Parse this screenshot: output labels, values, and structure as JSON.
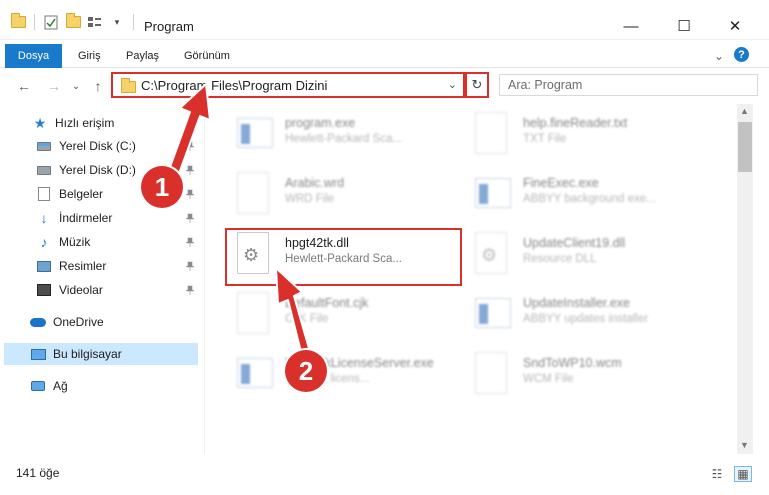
{
  "window": {
    "title": "Program",
    "minimize_glyph": "—",
    "maximize_glyph": "☐",
    "close_glyph": "✕"
  },
  "ribbon": {
    "tabs": [
      "Dosya",
      "Giriş",
      "Paylaş",
      "Görünüm"
    ],
    "chevron_glyph": "⌄",
    "help_glyph": "?"
  },
  "nav": {
    "back_glyph": "←",
    "forward_glyph": "→",
    "recent_glyph": "⌄",
    "up_glyph": "↑",
    "address_path": "C:\\Program Files\\Program Dizini",
    "address_dropdown_glyph": "⌄",
    "refresh_glyph": "↻",
    "search_placeholder": "Ara: Program"
  },
  "sidebar": {
    "items": [
      {
        "label": "Hızlı erişim",
        "icon": "star-icon"
      },
      {
        "label": "Yerel Disk (C:)",
        "icon": "drive-icon",
        "pinned": true
      },
      {
        "label": "Yerel Disk (D:)",
        "icon": "drive-icon",
        "pinned": true
      },
      {
        "label": "Belgeler",
        "icon": "document-icon",
        "pinned": true
      },
      {
        "label": "İndirmeler",
        "icon": "download-icon",
        "pinned": true
      },
      {
        "label": "Müzik",
        "icon": "music-icon",
        "pinned": true
      },
      {
        "label": "Resimler",
        "icon": "pictures-icon",
        "pinned": true
      },
      {
        "label": "Videolar",
        "icon": "videos-icon",
        "pinned": true
      },
      {
        "label": "OneDrive",
        "icon": "cloud-icon"
      },
      {
        "label": "Bu bilgisayar",
        "icon": "computer-icon",
        "selected": true
      },
      {
        "label": "Ağ",
        "icon": "network-icon"
      }
    ],
    "pin_glyph": "📌"
  },
  "files": [
    {
      "name": "program.exe",
      "type": "Hewlett-Packard Sca...",
      "icon": "application-icon"
    },
    {
      "name": "help.fineReader.txt",
      "type": "TXT File",
      "icon": "text-file-icon"
    },
    {
      "name": "Arabic.wrd",
      "type": "WRD File",
      "icon": "file-icon"
    },
    {
      "name": "FineExec.exe",
      "type": "ABBYY background exe...",
      "icon": "application-icon"
    },
    {
      "name": "hpgt42tk.dll",
      "type": "Hewlett-Packard Sca...",
      "icon": "dll-gear-icon",
      "highlighted": true
    },
    {
      "name": "UpdateClient19.dll",
      "type": "Resource DLL",
      "icon": "dll-gear-icon"
    },
    {
      "name": "DefaultFont.cjk",
      "type": "CJK File",
      "icon": "file-icon"
    },
    {
      "name": "UpdateInstaller.exe",
      "type": "ABBYY updates installer",
      "icon": "application-icon"
    },
    {
      "name": "NetworkLicenseServer.exe",
      "type": "Network licens...",
      "icon": "application-icon"
    },
    {
      "name": "SndToWP10.wcm",
      "type": "WCM File",
      "icon": "file-icon"
    }
  ],
  "status": {
    "item_count": "141 öğe",
    "details_view_glyph": "☷",
    "icons_view_glyph": "▦"
  },
  "annotations": {
    "step1": "1",
    "step2": "2",
    "accent_color": "#d9302c"
  },
  "colors": {
    "file_tab_bg": "#1979ca",
    "selected_nav_bg": "#cce8ff"
  }
}
